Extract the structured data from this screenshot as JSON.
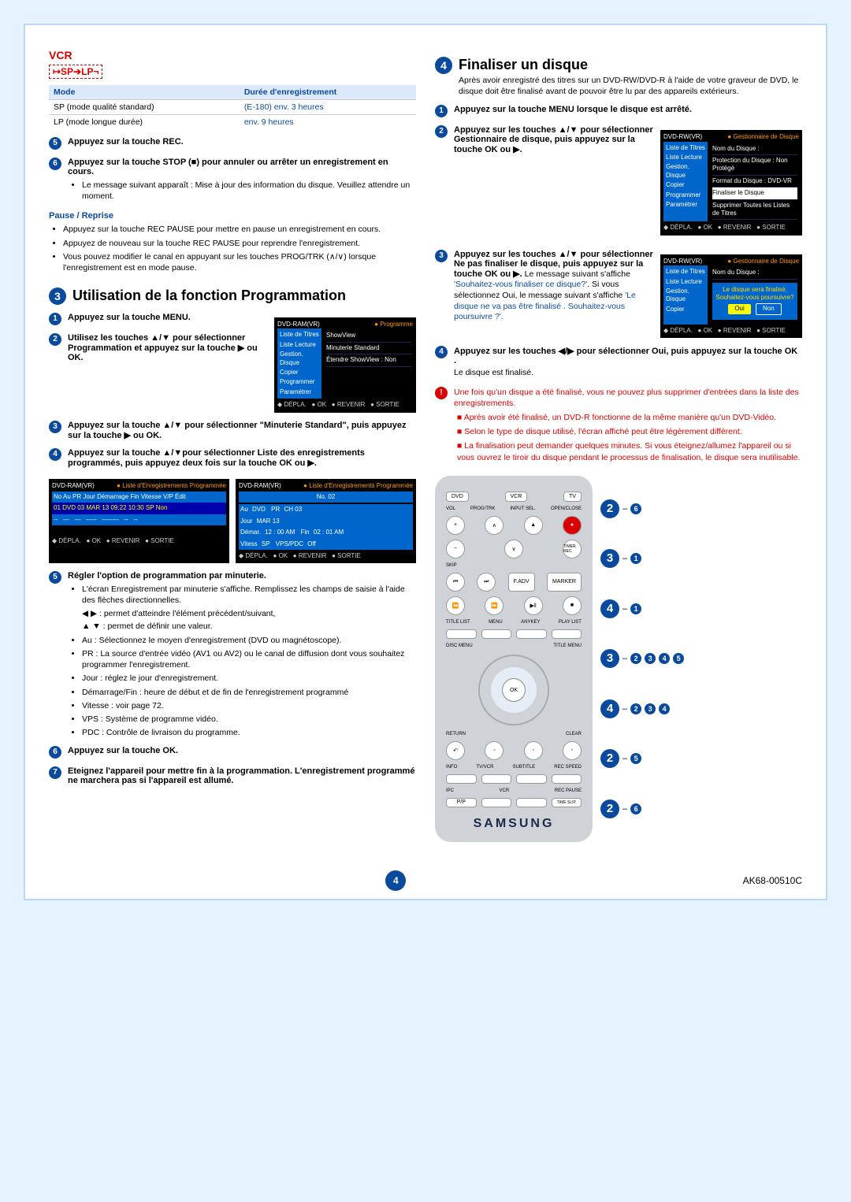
{
  "brand": "VCR",
  "mode_indicator": "↦SP➔LP¬",
  "table": {
    "h1": "Mode",
    "h2": "Durée d'enregistrement",
    "r1c1": "SP (mode qualité standard)",
    "r1c2": "(E-180) env. 3 heures",
    "r2c1": "LP (mode longue durée)",
    "r2c2": "env. 9 heures"
  },
  "left": {
    "s5": "Appuyez sur la touche REC.",
    "s6": "Appuyez sur la touche STOP (■) pour annuler ou arrêter un enregistrement en cours.",
    "s6_note": "Le message suivant apparaît : Mise à jour des information du disque. Veuillez attendre un moment.",
    "pause_head": "Pause / Reprise",
    "pause_b1": "Appuyez sur la touche REC PAUSE pour mettre en pause un enregistrement en cours.",
    "pause_b2": "Appuyez de nouveau sur la touche REC PAUSE pour reprendre l'enregistrement.",
    "pause_b3": "Vous pouvez modifier le canal en appuyant sur les touches PROG/TRK (∧/∨) lorsque l'enregistrement est en mode pause.",
    "sec3_head": "Utilisation de la fonction Programmation",
    "sec3_s1": "Appuyez sur la touche MENU.",
    "sec3_s2": "Utilisez les touches ▲/▼ pour sélectionner Programmation et appuyez sur la touche ▶ ou OK.",
    "sec3_s3": "Appuyez sur la touche ▲/▼ pour sélectionner \"Minuterie Standard\", puis appuyez sur la touche ▶ ou OK.",
    "sec3_s4": "Appuyez sur la touche ▲/▼pour sélectionner Liste des enregistrements programmés, puis appuyez deux fois sur la touche OK ou ▶.",
    "sec3_s5": "Régler l'option de programmation par minuterie.",
    "sec3_s5_b1": "L'écran Enregistrement par minuterie s'affiche. Remplissez les champs de saisie à l'aide des flèches directionnelles.",
    "sec3_s5_b1a": "◀ ▶ : permet d'atteindre l'élément précédent/suivant,",
    "sec3_s5_b1b": "▲ ▼ : permet de définir une valeur.",
    "sec3_s5_b2": "Au : Sélectionnez le moyen d'enregistrement (DVD ou magnétoscope).",
    "sec3_s5_b3": "PR : La source d'entrée vidéo (AV1 ou AV2) ou le canal de diffusion dont vous souhaitez programmer l'enregistrement.",
    "sec3_s5_b4": "Jour : réglez le jour d'enregistrement.",
    "sec3_s5_b5": "Démarrage/Fin : heure de début et de fin de l'enregistrement programmé",
    "sec3_s5_b6": "Vitesse : voir page 72.",
    "sec3_s5_b7": "VPS : Système de programme vidéo.",
    "sec3_s5_b8": "PDC : Contrôle de livraison du programme.",
    "sec3_s6": "Appuyez sur la touche OK.",
    "sec3_s7": "Eteignez l'appareil pour mettre fin à la programmation. L'enregistrement programmé ne marchera pas si l'appareil est allumé."
  },
  "osd1": {
    "title": "DVD-RAM(VR)",
    "cat": "Programme",
    "m1": "Liste de Titres",
    "m2": "Liste Lecture",
    "m3": "Gestion. Disque",
    "m4": "Copier",
    "m5": "Programmer",
    "m6": "Paramétrer",
    "i1": "ShowView",
    "i2": "Minuterie Standard",
    "i3_l": "Étendre ShowView",
    "i3_v": ": Non",
    "f1": "DÉPLA.",
    "f2": "OK",
    "f3": "REVENIR",
    "f4": "SORTIE"
  },
  "osd_list": {
    "title": "DVD-RAM(VR)",
    "cat": "Liste d'Enregistrements Programmée",
    "cols": "No  Au   PR   Jour   Démarrage   Fin   Vitesse   V/P Édit",
    "row": "01 DVD  03   MAR 13   09:22   10:30   SP   Non",
    "f1": "DÉPLA.",
    "f2": "OK",
    "f3": "REVENIR",
    "f4": "SORTIE"
  },
  "osd_edit": {
    "title": "DVD-RAM(VR)",
    "cat": "Liste d'Enregistrements Programmée",
    "noline": "No. 02",
    "au": "Au",
    "au_v": "DVD",
    "pr": "PR",
    "pr_v": "CH 03",
    "jour": "Jour",
    "jour_v": "MAR 13",
    "dem": "Démar.",
    "dem_v": "12 : 00 AM",
    "fin": "Fin",
    "fin_v": "02 : 01 AM",
    "vit": "Vitess",
    "vit_v": "SP",
    "vps": "VPS/PDC",
    "vps_v": "Off",
    "f1": "DÉPLA.",
    "f2": "OK",
    "f3": "REVENIR",
    "f4": "SORTIE"
  },
  "right": {
    "sec4_head": "Finaliser un disque",
    "sec4_intro": "Après avoir enregistré des titres sur un DVD-RW/DVD-R à l'aide de votre graveur de DVD, le disque doit être finalisé avant de pouvoir être lu par des appareils extérieurs.",
    "s1": "Appuyez sur la touche MENU lorsque le disque est arrêté.",
    "s2": "Appuyez sur les touches ▲/▼ pour sélectionner Gestionnaire de disque, puis appuyez sur la touche OK ou ▶.",
    "s3_a": "Appuyez sur les touches ▲/▼ pour sélectionner Ne pas finaliser le disque, puis appuyez sur la touche OK ou ▶.",
    "s3_b": " Le message suivant s'affiche ",
    "s3_c": "'Souhaitez-vous finaliser ce disque?'",
    "s3_d": ". Si vous sélectionnez Oui, le message suivant s'affiche ",
    "s3_e": "'Le disque ne va pas être finalisé . Souhaitez-vous poursuivre ?'.",
    "s4": "Appuyez sur les touches ◀/▶ pour sélectionner Oui, puis appuyez sur la touche OK .",
    "s4_note": "Le disque est finalisé.",
    "warn1": "Une fois qu'un disque a été finalisé, vous ne pouvez plus supprimer d'entrées dans la liste des enregistrements.",
    "warn_b1": "Après avoir été finalisé, un DVD-R fonctionne de la même manière qu'un DVD-Vidéo.",
    "warn_b2": "Selon le type de disque utilisé, l'écran affiché peut être légèrement différent.",
    "warn_b3": "La finalisation peut demander quelques minutes. Si vous éteignez/allumez l'appareil ou si vous ouvrez le tiroir du disque pendant le processus de finalisation, le disque sera inutilisable."
  },
  "osd2": {
    "title": "DVD-RW(VR)",
    "cat": "Gestionnaire de Disque",
    "i1": "Nom du Disque :",
    "i2": "Protection du Disque : Non Protégé",
    "i3": "Format du Disque : DVD-VR",
    "i4": "Finaliser le Disque",
    "i5": "Supprimer Toutes les Listes de Titres",
    "f1": "DÉPLA.",
    "f2": "OK",
    "f3": "REVENIR",
    "f4": "SORTIE"
  },
  "osd3": {
    "title": "DVD-RW(VR)",
    "cat": "Gestionnaire de Disque",
    "i1": "Nom du Disque :",
    "dlg1": "Le disque sera finalisé.",
    "dlg2": "Souhaitez-vous poursuivre?",
    "oui": "Oui",
    "non": "Non",
    "f1": "DÉPLA.",
    "f2": "OK",
    "f3": "REVENIR",
    "f4": "SORTIE"
  },
  "remote": {
    "dvd": "DVD",
    "vcr": "VCR",
    "tv": "TV",
    "inputsel": "INPUT SEL.",
    "progtrk": "PROG/TRK",
    "openclose": "OPEN/CLOSE",
    "vol": "VOL",
    "timer": "TIMER REC",
    "skip": "SKIP",
    "fadv": "F.ADV",
    "marker": "MARKER",
    "titlelist": "TITLE LIST",
    "menu": "MENU",
    "anykey": "ANYKEY",
    "playlist": "PLAY LIST",
    "discmenu": "DISC MENU",
    "titlemenu": "TITLE MENU",
    "ok": "OK",
    "return": "RETURN",
    "clear": "CLEAR",
    "info": "INFO",
    "tvvcr": "TV/VCR",
    "subtitle": "SUBTITLE",
    "recspeed": "REC SPEED",
    "ipc": "IPC",
    "pip": "P/P",
    "vcr2": "VCR",
    "recpause": "REC PAUSE",
    "timeslip": "TIME SLIP",
    "logo": "SAMSUNG"
  },
  "callouts": [
    {
      "big": "2",
      "small": [
        "6"
      ]
    },
    {
      "big": "3",
      "small": [
        "1"
      ]
    },
    {
      "big": "4",
      "small": [
        "1"
      ]
    },
    {
      "big": "3",
      "small": [
        "2",
        "3",
        "4",
        "5"
      ]
    },
    {
      "big": "4",
      "small": [
        "2",
        "3",
        "4"
      ]
    },
    {
      "big": "2",
      "small": [
        "5"
      ]
    },
    {
      "big": "2",
      "small": [
        "6"
      ]
    }
  ],
  "footer": {
    "pg": "4",
    "code": "AK68-00510C"
  }
}
